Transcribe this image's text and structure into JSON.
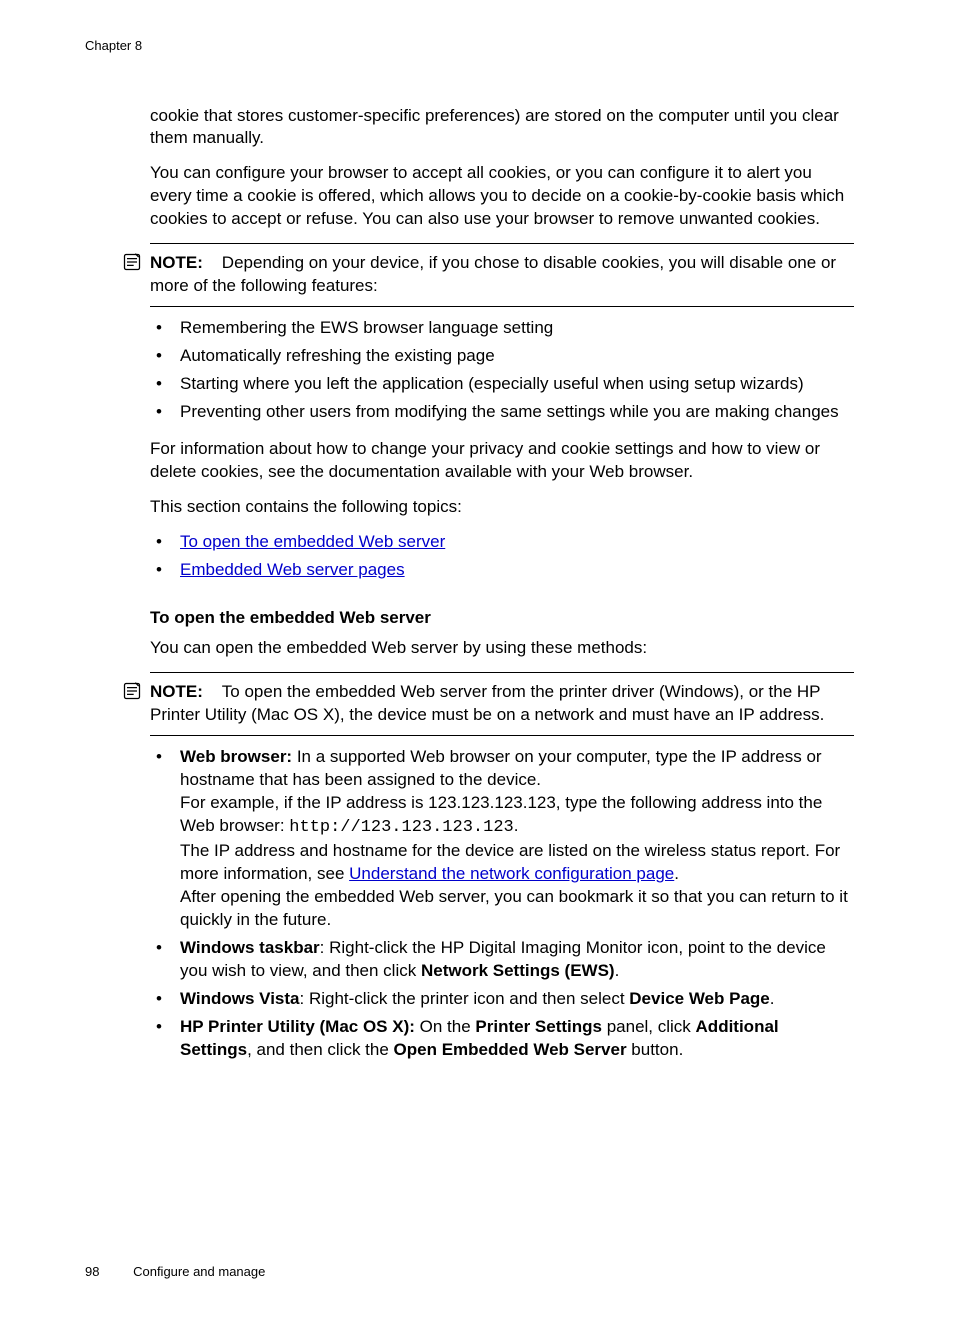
{
  "header": {
    "chapter": "Chapter 8"
  },
  "content": {
    "para1": "cookie that stores customer-specific preferences) are stored on the computer until you clear them manually.",
    "para2": "You can configure your browser to accept all cookies, or you can configure it to alert you every time a cookie is offered, which allows you to decide on a cookie-by-cookie basis which cookies to accept or refuse. You can also use your browser to remove unwanted cookies.",
    "note1": {
      "label": "NOTE:",
      "text": "Depending on your device, if you chose to disable cookies, you will disable one or more of the following features:"
    },
    "list1": [
      "Remembering the EWS browser language setting",
      "Automatically refreshing the existing page",
      "Starting where you left the application (especially useful when using setup wizards)",
      "Preventing other users from modifying the same settings while you are making changes"
    ],
    "para3": "For information about how to change your privacy and cookie settings and how to view or delete cookies, see the documentation available with your Web browser.",
    "para4": "This section contains the following topics:",
    "links1": [
      "To open the embedded Web server",
      "Embedded Web server pages"
    ],
    "heading1": "To open the embedded Web server",
    "para5": "You can open the embedded Web server by using these methods:",
    "note2": {
      "label": "NOTE:",
      "text": "To open the embedded Web server from the printer driver (Windows), or the HP Printer Utility (Mac OS X), the device must be on a network and must have an IP address."
    },
    "list2": {
      "item1": {
        "bold1": "Web browser:",
        "text1": " In a supported Web browser on your computer, type the IP address or hostname that has been assigned to the device.",
        "text2": "For example, if the IP address is 123.123.123.123, type the following address into the Web browser: ",
        "mono1": "http://123.123.123.123",
        "text3": ".",
        "text4": "The IP address and hostname for the device are listed on the wireless status report. For more information, see ",
        "link1": "Understand the network configuration page",
        "text5": ".",
        "text6": "After opening the embedded Web server, you can bookmark it so that you can return to it quickly in the future."
      },
      "item2": {
        "bold1": "Windows taskbar",
        "text1": ": Right-click the HP Digital Imaging Monitor icon, point to the device you wish to view, and then click ",
        "bold2": "Network Settings (EWS)",
        "text2": "."
      },
      "item3": {
        "bold1": "Windows Vista",
        "text1": ": Right-click the printer icon and then select ",
        "bold2": "Device Web Page",
        "text2": "."
      },
      "item4": {
        "bold1": "HP Printer Utility (Mac OS X):",
        "text1": " On the ",
        "bold2": "Printer Settings",
        "text2": " panel, click ",
        "bold3": "Additional Settings",
        "text3": ", and then click the ",
        "bold4": "Open Embedded Web Server",
        "text4": " button."
      }
    }
  },
  "footer": {
    "page": "98",
    "section": "Configure and manage"
  }
}
